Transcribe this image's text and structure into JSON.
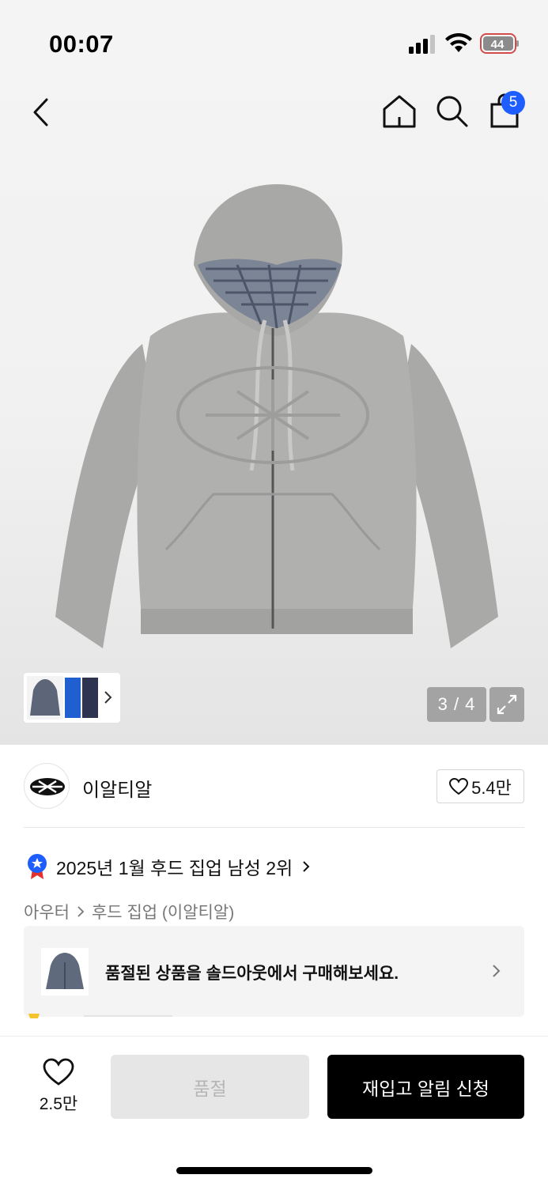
{
  "status_bar": {
    "time": "00:07",
    "battery": "44"
  },
  "header": {
    "cart_count": "5"
  },
  "gallery": {
    "counter": "3 / 4"
  },
  "brand": {
    "name": "이알티알",
    "likes": "5.4만"
  },
  "ranking": {
    "text": "2025년 1월 후드 집업 남성 2위"
  },
  "breadcrumb": {
    "category": "아우터",
    "subcategory": "후드 집업 (이알티알)"
  },
  "banner": {
    "text": "품절된 상품을 솔드아웃에서 구매해보세요."
  },
  "bottom": {
    "like_count": "2.5만",
    "soldout_label": "품절",
    "restock_label": "재입고 알림 신청"
  },
  "colors": {
    "accent_blue": "#1e5eff",
    "black": "#000000",
    "disabled_bg": "#e6e6e6"
  }
}
